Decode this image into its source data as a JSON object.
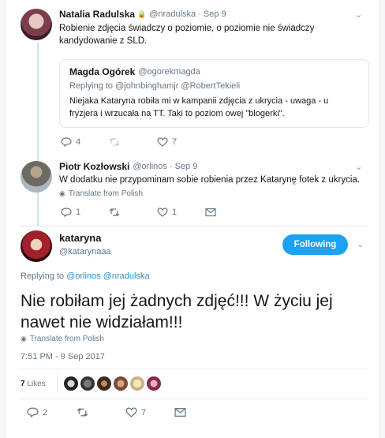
{
  "tweet1": {
    "name": "Natalia Radulska",
    "handle": "@nradulska",
    "date": "Sep 9",
    "text": "Robienie zdjęcia świadczy o poziomie, o poziomie nie świadczy kandydowanie z SLD.",
    "quote": {
      "name": "Magda Ogórek",
      "handle": "@ogorekmagda",
      "replying_label": "Replying to",
      "replying_users": "@johnbinghamjr @RobertTekieli",
      "text": "Niejaka Kataryna robiła mi w kampanii zdjęcia z ukrycia  - uwaga - u fryzjera i wrzucała na TT. Taki to poziom owej \"blogerki\"."
    },
    "replies": "4",
    "likes": "7"
  },
  "tweet2": {
    "name": "Piotr Kozłowski",
    "handle": "@orlinos",
    "date": "Sep 9",
    "text": "W dodatku nie przypominam sobie robienia przez Katarynę fotek z ukrycia.",
    "translate": "Translate from Polish",
    "replies": "1",
    "likes": "1"
  },
  "main": {
    "name": "kataryna",
    "handle": "@katarynaaa",
    "follow_label": "Following",
    "replying_label": "Replying to",
    "replying_users": "@orlinos @nradulska",
    "text": "Nie robiłam jej żadnych zdjęć!!! W życiu jej nawet nie widziałam!!!",
    "translate": "Translate from Polish",
    "timestamp": "7:51 PM - 9 Sep 2017",
    "likes_count": "7",
    "likes_label": "Likes",
    "replies": "2",
    "like_action_count": "7"
  },
  "colors": {
    "accent": "#1da1f2",
    "link": "#1b95e0",
    "muted": "#657786",
    "thread_line": "#cfe3f3"
  },
  "icons": [
    "chevron-down-icon",
    "reply-icon",
    "retweet-icon",
    "heart-icon",
    "message-icon",
    "globe-icon",
    "lock-icon"
  ]
}
